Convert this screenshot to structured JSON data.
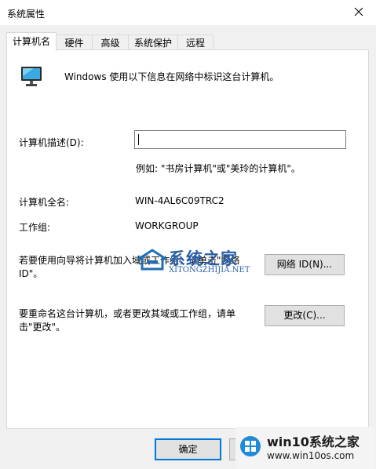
{
  "window": {
    "title": "系统属性"
  },
  "tabs": [
    {
      "label": "计算机名",
      "active": true
    },
    {
      "label": "硬件",
      "active": false
    },
    {
      "label": "高级",
      "active": false
    },
    {
      "label": "系统保护",
      "active": false
    },
    {
      "label": "远程",
      "active": false
    }
  ],
  "panel": {
    "intro": "Windows 使用以下信息在网络中标识这台计算机。",
    "description_label": "计算机描述(D):",
    "description_value": "",
    "example": "例如: \"书房计算机\"或\"美玲的计算机\"。",
    "fullname_label": "计算机全名:",
    "fullname_value": "WIN-4AL6C09TRC2",
    "workgroup_label": "工作组:",
    "workgroup_value": "WORKGROUP",
    "network_text": "若要使用向导将计算机加入域或工作组，请单击\"网络 ID\"。",
    "network_button": "网络 ID(N)...",
    "rename_text": "要重命名这台计算机，或者更改其域或工作组，请单击\"更改\"。",
    "rename_button": "更改(C)..."
  },
  "footer": {
    "ok_button": "确定"
  },
  "watermark": {
    "center_logo": "系统之家",
    "center_url": "XITONGZHIJIA.NET",
    "corner_title": "win10系统之家",
    "corner_url": "www.win10os.com"
  },
  "colors": {
    "accent": "#0078d7",
    "watermark_blue": "#1f6fb5"
  },
  "icons": {
    "computer": "monitor-icon",
    "close": "close-icon"
  }
}
